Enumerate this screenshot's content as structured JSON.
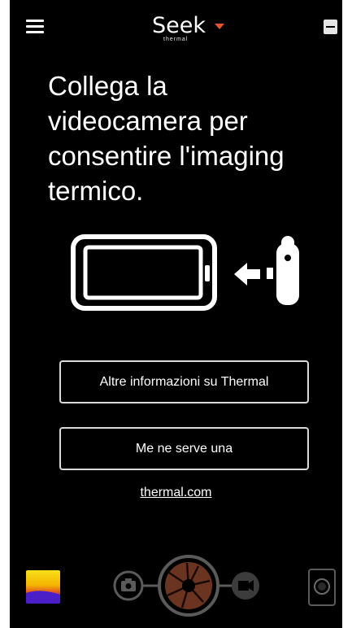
{
  "header": {
    "brand_name": "Seek",
    "brand_sub": "thermal",
    "menu_icon": "hamburger-menu-icon",
    "minimize_icon": "minimize-icon"
  },
  "main": {
    "message": "Collega la videocamera per consentire l'imaging termico.",
    "illustration_icon": "phone-connect-camera-icon",
    "info_button": "Altre informazioni su Thermal",
    "need_button": "Me ne serve una",
    "link": "thermal.com"
  },
  "bottom": {
    "palette_icon": "color-palette-icon",
    "photo_icon": "photo-camera-icon",
    "shutter_icon": "shutter-aperture-icon",
    "video_icon": "video-camera-icon",
    "gallery_icon": "gallery-icon"
  },
  "colors": {
    "background": "#000000",
    "accent": "#e8542a",
    "shutter": "#6b3420"
  }
}
